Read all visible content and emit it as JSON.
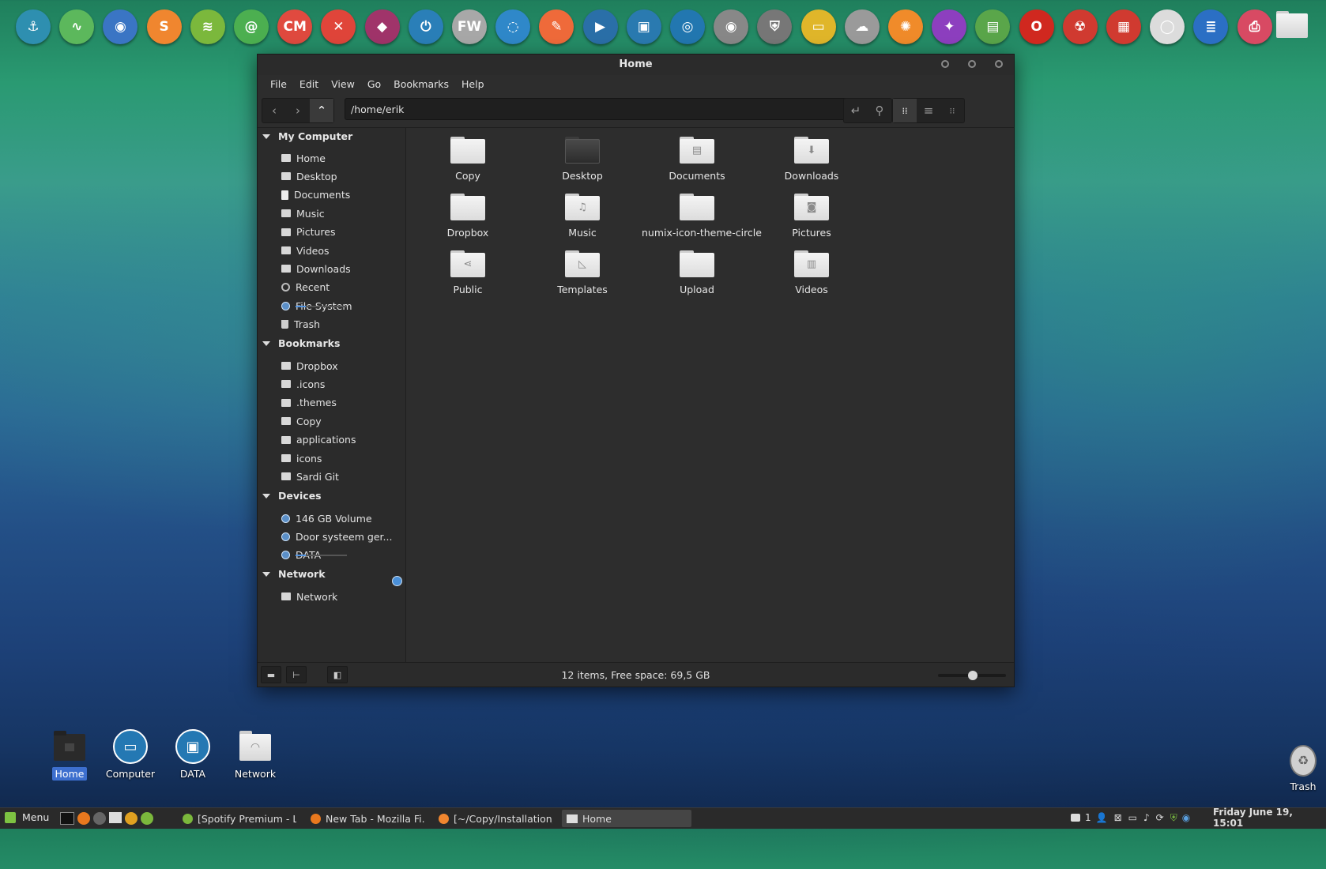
{
  "dock": {
    "items": [
      {
        "name": "anchor-icon",
        "bg": "#2e8fb0",
        "glyph": "⚓"
      },
      {
        "name": "system-monitor-icon",
        "bg": "#5cb85c",
        "glyph": "∿"
      },
      {
        "name": "firefox-icon",
        "bg": "#3a75c4",
        "glyph": "◉"
      },
      {
        "name": "sublime-icon",
        "bg": "#f0862f",
        "glyph": "S"
      },
      {
        "name": "spotify-icon",
        "bg": "#7bb83c",
        "glyph": "≋"
      },
      {
        "name": "mail-icon",
        "bg": "#4caf50",
        "glyph": "@"
      },
      {
        "name": "clipman-icon",
        "bg": "#e04a3f",
        "glyph": "CM"
      },
      {
        "name": "tools-icon",
        "bg": "#e0453a",
        "glyph": "✕"
      },
      {
        "name": "inkscape-icon",
        "bg": "#a0346a",
        "glyph": "◆"
      },
      {
        "name": "power-icon",
        "bg": "#2a7fb8",
        "glyph": "⏻"
      },
      {
        "name": "fw-icon",
        "bg": "#a8a8a8",
        "glyph": "FW"
      },
      {
        "name": "circle-icon",
        "bg": "#2f88c9",
        "glyph": "◌"
      },
      {
        "name": "pencil-icon",
        "bg": "#ef6a3a",
        "glyph": "✎"
      },
      {
        "name": "video-icon",
        "bg": "#2a6fa8",
        "glyph": "▶"
      },
      {
        "name": "image-icon",
        "bg": "#2a7ab0",
        "glyph": "▣"
      },
      {
        "name": "blue-app-icon",
        "bg": "#2277b0",
        "glyph": "◎"
      },
      {
        "name": "disc-icon",
        "bg": "#888",
        "glyph": "◉"
      },
      {
        "name": "shield-icon",
        "bg": "#777",
        "glyph": "⛨"
      },
      {
        "name": "ruler-icon",
        "bg": "#e0b62a",
        "glyph": "▭"
      },
      {
        "name": "cloud-icon",
        "bg": "#9a9a9a",
        "glyph": "☁"
      },
      {
        "name": "orange-icon",
        "bg": "#f08b2a",
        "glyph": "✺"
      },
      {
        "name": "purple-icon",
        "bg": "#8d3fbf",
        "glyph": "✦"
      },
      {
        "name": "card-icon",
        "bg": "#5aa64a",
        "glyph": "▤"
      },
      {
        "name": "opera-icon",
        "bg": "#d0281f",
        "glyph": "O"
      },
      {
        "name": "radiation-icon",
        "bg": "#d03a30",
        "glyph": "☢"
      },
      {
        "name": "calculator-icon",
        "bg": "#d03a30",
        "glyph": "▦"
      },
      {
        "name": "chrome-icon",
        "bg": "#dcdcdc",
        "glyph": "◯"
      },
      {
        "name": "news-icon",
        "bg": "#2b6fc4",
        "glyph": "≣"
      },
      {
        "name": "printer-icon",
        "bg": "#d84a63",
        "glyph": "⎙"
      }
    ]
  },
  "window": {
    "title": "Home",
    "menu": [
      "File",
      "Edit",
      "View",
      "Go",
      "Bookmarks",
      "Help"
    ],
    "path": "/home/erik",
    "status": "12 items, Free space: 69,5 GB"
  },
  "sidebar": {
    "sections": {
      "my_computer": "My Computer",
      "bookmarks": "Bookmarks",
      "devices": "Devices",
      "network": "Network"
    },
    "my_computer": [
      "Home",
      "Desktop",
      "Documents",
      "Music",
      "Pictures",
      "Videos",
      "Downloads",
      "Recent",
      "File System",
      "Trash"
    ],
    "bookmarks": [
      "Dropbox",
      ".icons",
      ".themes",
      "Copy",
      "applications",
      "icons",
      "Sardi Git"
    ],
    "devices": [
      "146 GB Volume",
      "Door systeem ger...",
      "DATA"
    ],
    "network": [
      "Network"
    ],
    "usage": {
      "file_system": 0.2,
      "data": 0.2
    }
  },
  "files": [
    {
      "label": "Copy",
      "emblem": ""
    },
    {
      "label": "Desktop",
      "emblem": "",
      "dark": true
    },
    {
      "label": "Documents",
      "emblem": "▤"
    },
    {
      "label": "Downloads",
      "emblem": "⬇"
    },
    {
      "label": "Dropbox",
      "emblem": ""
    },
    {
      "label": "Music",
      "emblem": "♫"
    },
    {
      "label": "numix-icon-theme-circle",
      "emblem": ""
    },
    {
      "label": "Pictures",
      "emblem": "◙"
    },
    {
      "label": "Public",
      "emblem": "⋖"
    },
    {
      "label": "Templates",
      "emblem": "◺"
    },
    {
      "label": "Upload",
      "emblem": ""
    },
    {
      "label": "Videos",
      "emblem": "▥"
    }
  ],
  "desktop": {
    "icons": [
      "Home",
      "Computer",
      "DATA",
      "Network"
    ],
    "trash": "Trash"
  },
  "taskbar": {
    "menu": "Menu",
    "tasks": [
      "[Spotify Premium - Li...",
      "New Tab - Mozilla Fi...",
      "[~/Copy/Installation/...",
      "Home"
    ],
    "tray_count": "1",
    "clock": "Friday June 19, 15:01"
  }
}
